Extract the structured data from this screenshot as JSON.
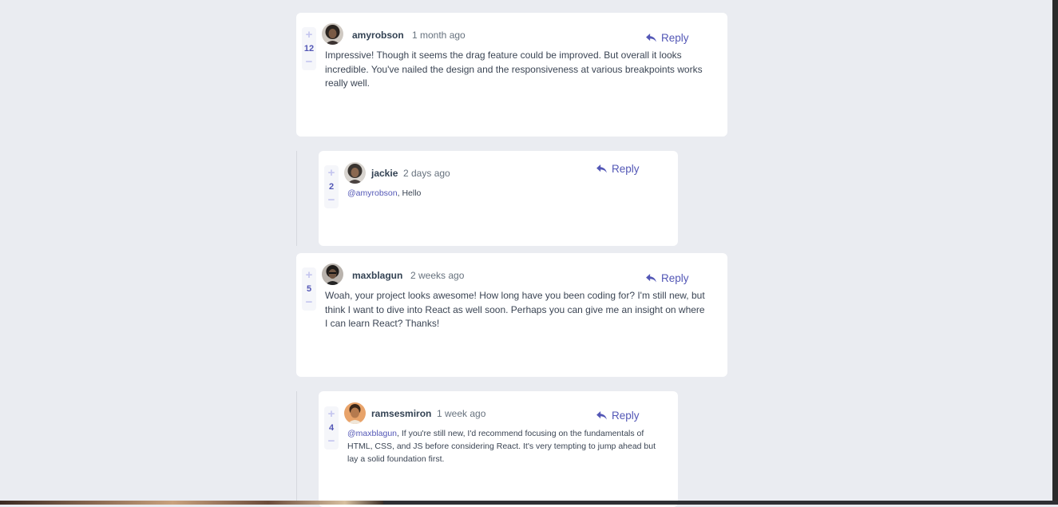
{
  "reply_label": "Reply",
  "colors": {
    "accent": "#5357b6",
    "page_bg": "#eaecf1",
    "card_bg": "#ffffff"
  },
  "vote_icons": {
    "up": "plus-icon",
    "down": "minus-icon"
  },
  "comments": [
    {
      "username": "amyrobson",
      "time": "1 month ago",
      "score": "12",
      "avatar": "avatar-amyrobson",
      "content": "Impressive! Though it seems the drag feature could be improved. But overall it looks incredible. You've nailed the design and the responsiveness at various breakpoints works really well."
    },
    {
      "username": "jackie",
      "time": "2 days ago",
      "score": "2",
      "avatar": "avatar-jackie",
      "mention": "@amyrobson",
      "content": ", Hello"
    },
    {
      "username": "maxblagun",
      "time": "2 weeks ago",
      "score": "5",
      "avatar": "avatar-maxblagun",
      "content": "Woah, your project looks awesome! How long have you been coding for? I'm still new, but think I want to dive into React as well soon. Perhaps you can give me an insight on where I can learn React? Thanks!"
    },
    {
      "username": "ramsesmiron",
      "time": "1 week ago",
      "score": "4",
      "avatar": "avatar-ramsesmiron",
      "mention": "@maxblagun",
      "content": ", If you're still new, I'd recommend focusing on the fundamentals of HTML, CSS, and JS before considering React. It's very tempting to jump ahead but lay a solid foundation first."
    }
  ]
}
